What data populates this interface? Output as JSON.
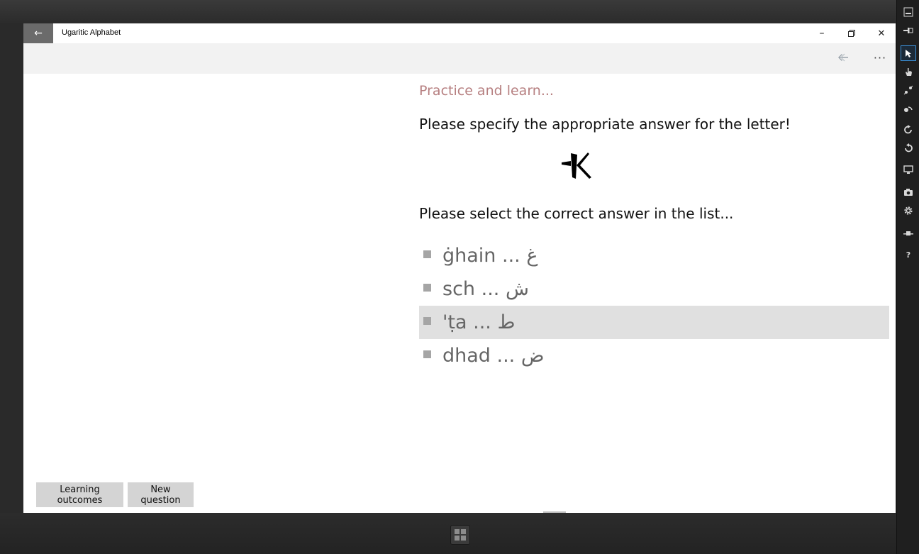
{
  "window": {
    "title": "Ugaritic Alphabet",
    "back_icon": "←",
    "minimize_icon": "–",
    "restore_icon": "❐",
    "close_icon": "✕"
  },
  "commandbar": {
    "back_icon": "🡰",
    "more_icon": "···"
  },
  "quiz": {
    "heading": "Practice and learn...",
    "prompt": "Please specify the appropriate answer for the letter!",
    "letter_icon": "ugaritic-letter-tha-icon",
    "select_prompt": "Please select the correct answer in the list...",
    "answers": [
      {
        "text": "ġhain ... غ",
        "selected": false
      },
      {
        "text": "sch ... ش",
        "selected": false
      },
      {
        "text": "'ṭa ... ط",
        "selected": true
      },
      {
        "text": "dhad ... ض",
        "selected": false
      }
    ]
  },
  "buttons": {
    "learning_outcomes": "Learning outcomes",
    "new_question": "New question"
  },
  "colors": {
    "heading": "#b67f80",
    "selected_row": "#e0e0e0",
    "button_bg": "#d4d4d4",
    "titlebar_back": "#6b6b6b"
  },
  "sim_toolbar": {
    "tools": [
      "minimize-icon",
      "pin-icon",
      "pointer-icon",
      "touch-icon",
      "pinch-zoom-icon",
      "rotation-icon",
      "rotate-clockwise-icon",
      "rotate-counterclockwise-icon",
      "resolution-icon",
      "screenshot-icon",
      "settings-icon",
      "network-icon",
      "help-icon"
    ]
  }
}
